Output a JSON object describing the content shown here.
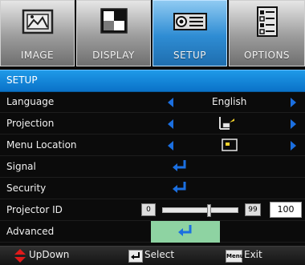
{
  "tabs": [
    {
      "label": "IMAGE",
      "active": false,
      "icon": "image-icon"
    },
    {
      "label": "DISPLAY",
      "active": false,
      "icon": "display-icon"
    },
    {
      "label": "SETUP",
      "active": true,
      "icon": "projector-icon"
    },
    {
      "label": "OPTIONS",
      "active": false,
      "icon": "options-icon"
    }
  ],
  "title": "SETUP",
  "menu": {
    "language": {
      "label": "Language",
      "value": "English"
    },
    "projection": {
      "label": "Projection",
      "icon": "front-projection-icon"
    },
    "menu_location": {
      "label": "Menu Location",
      "icon": "menu-location-icon"
    },
    "signal": {
      "label": "Signal",
      "icon": "enter-icon"
    },
    "security": {
      "label": "Security",
      "icon": "enter-icon"
    },
    "projector_id": {
      "label": "Projector ID",
      "min": "0",
      "max": "99",
      "value": "100",
      "level_fraction": 0.62
    },
    "advanced": {
      "label": "Advanced",
      "icon": "enter-icon"
    }
  },
  "footer": {
    "updown_label": "UpDown",
    "select_label": "Select",
    "menu_key": "Menu",
    "exit_label": "Exit"
  },
  "colors": {
    "accent_blue": "#0a72c8",
    "arrow_blue": "#1b6fe0",
    "highlight_green": "#8ed3a2",
    "updown_red": "#e11a1a"
  }
}
